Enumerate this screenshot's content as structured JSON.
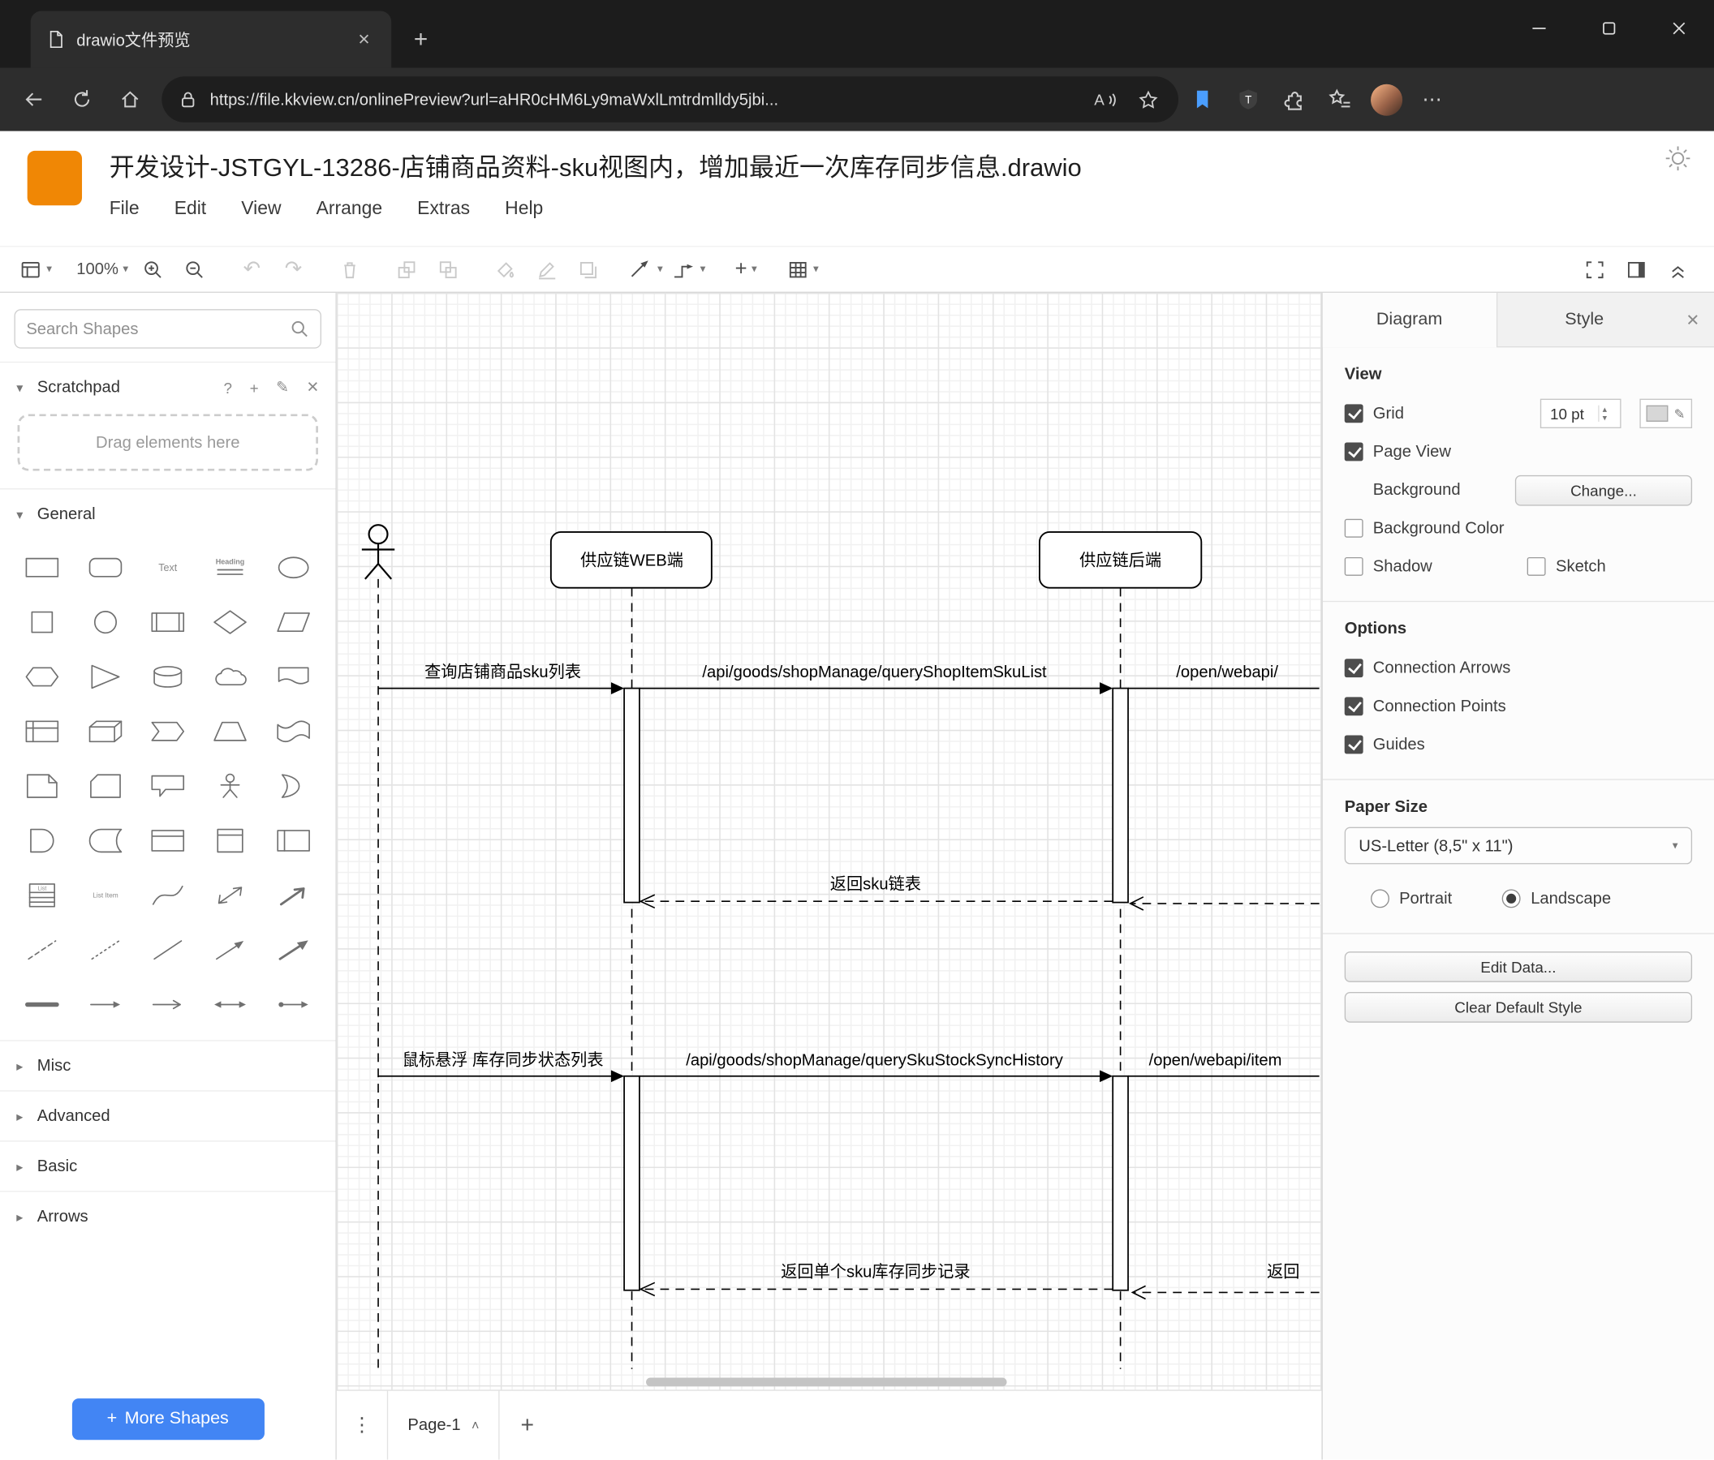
{
  "browser": {
    "tab_title": "drawio文件预览",
    "url": "https://file.kkview.cn/onlinePreview?url=aHR0cHM6Ly9maWxlLmtrdmlldy5jbi...",
    "url_host": "file.kkview.cn"
  },
  "icons": {
    "chevron_down": "▾",
    "chevron_right": "▸",
    "chevron_up": "˄",
    "undo": "↶",
    "redo": "↷",
    "plus": "+",
    "question": "?",
    "pencil": "✎",
    "close": "✕",
    "more": "⋯",
    "dots": "⋮",
    "read_aloud": "A",
    "up": "▴",
    "down": "▾"
  },
  "app": {
    "doc_title": "开发设计-JSTGYL-13286-店铺商品资料-sku视图内，增加最近一次库存同步信息.drawio",
    "menus": [
      "File",
      "Edit",
      "View",
      "Arrange",
      "Extras",
      "Help"
    ],
    "toolbar": {
      "zoom": "100%"
    }
  },
  "sidebar": {
    "search_placeholder": "Search Shapes",
    "scratchpad_title": "Scratchpad",
    "scratchpad_hint": "Drag elements here",
    "general_title": "General",
    "collapsed_sections": [
      "Misc",
      "Advanced",
      "Basic",
      "Arrows"
    ],
    "shapes": [
      "rectangle",
      "rounded-rectangle",
      "text",
      "heading",
      "ellipse",
      "square",
      "circle",
      "process",
      "diamond",
      "parallelogram",
      "hexagon",
      "triangle",
      "cylinder",
      "cloud",
      "document",
      "internal-storage",
      "cube",
      "step",
      "trapezoid",
      "tape",
      "note",
      "card",
      "callout",
      "actor",
      "or",
      "and",
      "data-storage",
      "container",
      "vertical-container",
      "horizontal-container",
      "list",
      "list-item",
      "curve",
      "bidirectional-arrow",
      "block-arrow",
      "dashed-line",
      "dotted-line",
      "line",
      "arrow-ne",
      "arrow-ne-2",
      "link",
      "arrow",
      "simple-arrow",
      "double-arrow",
      "connector-arrow"
    ],
    "shape_texts": {
      "text": "Text",
      "heading": "Heading",
      "list": "List",
      "list_item": "List Item"
    },
    "more_shapes": "More Shapes"
  },
  "canvas": {
    "page_tab": "Page-1"
  },
  "diagram": {
    "lifelines": {
      "web": "供应链WEB端",
      "backend": "供应链后端"
    },
    "messages": {
      "m1": "查询店铺商品sku列表",
      "m2": "/api/goods/shopManage/queryShopItemSkuList",
      "m2b": "/open/webapi/",
      "r1": "返回sku链表",
      "m3": "鼠标悬浮 库存同步状态列表",
      "m4": "/api/goods/shopManage/querySkuStockSyncHistory",
      "m4b": "/open/webapi/item",
      "r2": "返回单个sku库存同步记录",
      "r2b": "返回"
    }
  },
  "format_panel": {
    "tab_diagram": "Diagram",
    "tab_style": "Style",
    "view": {
      "heading": "View",
      "grid": "Grid",
      "grid_size": "10 pt",
      "page_view": "Page View",
      "background": "Background",
      "change": "Change...",
      "background_color": "Background Color",
      "shadow": "Shadow",
      "sketch": "Sketch"
    },
    "options": {
      "heading": "Options",
      "items": [
        "Connection Arrows",
        "Connection Points",
        "Guides"
      ]
    },
    "paper": {
      "heading": "Paper Size",
      "size_value": "US-Letter (8,5\" x 11\")",
      "portrait": "Portrait",
      "landscape": "Landscape"
    },
    "edit_data": "Edit Data...",
    "clear_default_style": "Clear Default Style"
  }
}
